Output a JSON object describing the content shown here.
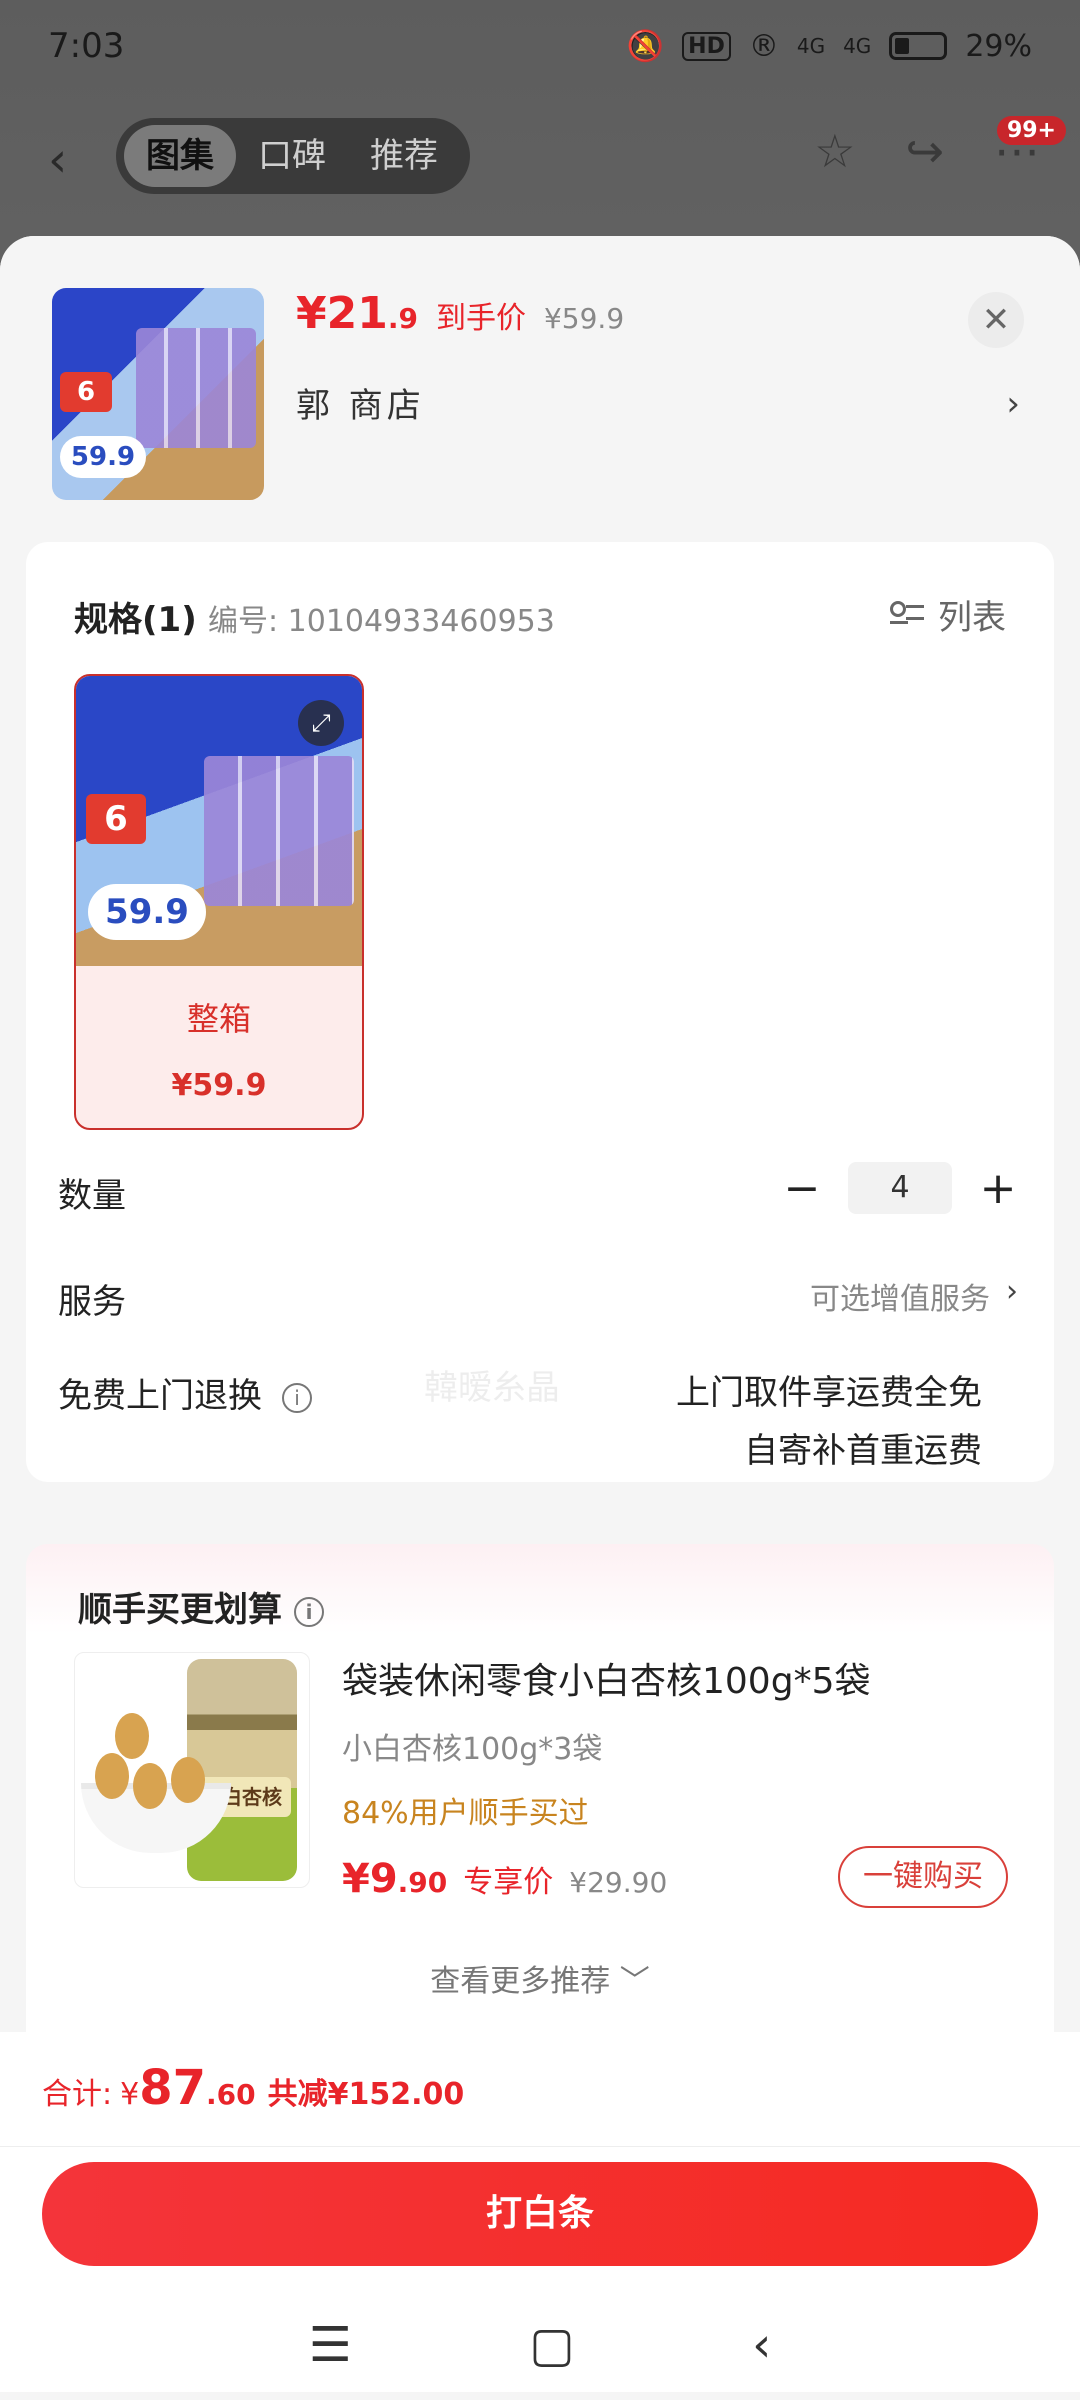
{
  "status_bar": {
    "time": "7:03",
    "hd": "HD",
    "signal": "4G",
    "battery": "29%"
  },
  "top_nav": {
    "tabs": [
      "图集",
      "口碑",
      "推荐"
    ],
    "active_tab": 0,
    "badge": "99+"
  },
  "product": {
    "price_int": "¥21",
    "price_dec": ".9",
    "price_tag": "到手价",
    "orig_price": "¥59.9",
    "shop": "郭 商店",
    "thumb_badge": "6",
    "thumb_price": "59.9"
  },
  "spec": {
    "title": "规格(1)",
    "code": "编号: 10104933460953",
    "list_label": "列表",
    "option": {
      "label": "整箱",
      "price": "¥59.9",
      "img_badge": "6",
      "img_price": "59.9"
    }
  },
  "quantity": {
    "label": "数量",
    "value": "4",
    "minus": "−",
    "plus": "+"
  },
  "service": {
    "label": "服务",
    "value": "可选增值服务"
  },
  "returns": {
    "label": "免费上门退换",
    "line1": "上门取件享运费全免",
    "line2": "自寄补首重运费"
  },
  "recommend": {
    "title": "顺手买更划算",
    "name": "袋装休闲零食小白杏核100g*5袋",
    "spec": "小白杏核100g*3袋",
    "stat": "84%用户顺手买过",
    "price_int": "¥9",
    "price_dec": ".90",
    "price_tag": "专享价",
    "orig_price": "¥29.90",
    "buy_label": "一键购买",
    "bag_label": "小白杏核",
    "more": "查看更多推荐 ﹀"
  },
  "total": {
    "label": "合计:",
    "currency": "¥",
    "amount_int": "87",
    "amount_dec": ".60",
    "saved": "共减¥152.00"
  },
  "pay_button": "打白条",
  "watermark": "韓暧糸晶",
  "colors": {
    "accent": "#e8242a",
    "bg": "#f5f5f5"
  }
}
